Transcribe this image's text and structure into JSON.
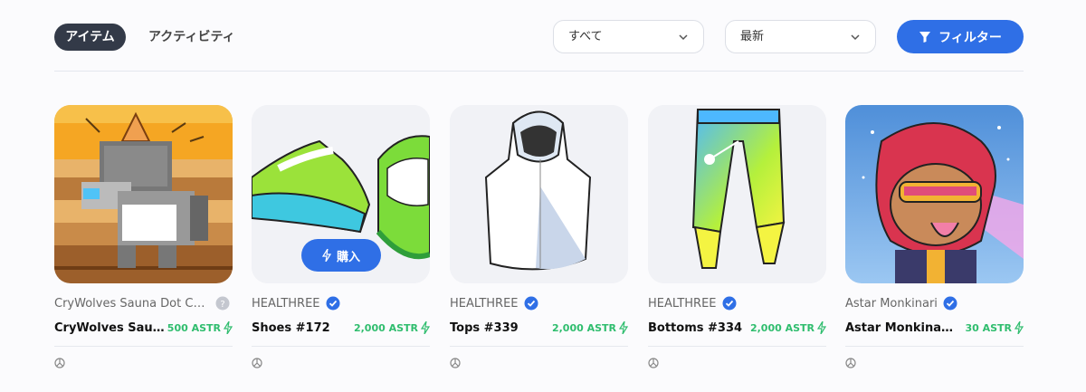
{
  "tabs": {
    "active": "アイテム",
    "inactive": "アクティビティ"
  },
  "filters": {
    "category_selected": "すべて",
    "sort_selected": "最新",
    "filter_button": "フィルター"
  },
  "colors": {
    "accent": "#2f6fe6",
    "price": "#2fbd6e",
    "active_tab": "#333a48"
  },
  "cards": [
    {
      "collection": "CryWolves Sauna Dot Coll...",
      "verified": false,
      "name": "CryWolves Saun...",
      "price": "500 ASTR",
      "image": "pixel-wolf-sauna"
    },
    {
      "collection": "HEALTHREE",
      "verified": true,
      "name": "Shoes #172",
      "price": "2,000 ASTR",
      "image": "green-sneakers",
      "buy_label": "購入"
    },
    {
      "collection": "HEALTHREE",
      "verified": true,
      "name": "Tops #339",
      "price": "2,000 ASTR",
      "image": "white-hoodie"
    },
    {
      "collection": "HEALTHREE",
      "verified": true,
      "name": "Bottoms #334",
      "price": "2,000 ASTR",
      "image": "gradient-pants"
    },
    {
      "collection": "Astar Monkinari",
      "verified": true,
      "name": "Astar Monkinari #...",
      "price": "30 ASTR",
      "image": "monkey-visor"
    }
  ]
}
